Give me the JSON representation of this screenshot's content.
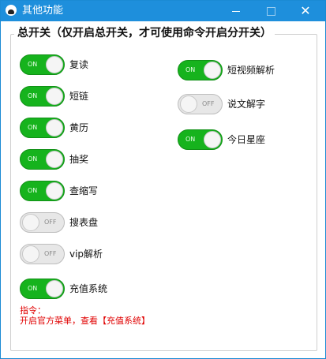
{
  "window": {
    "title": "其他功能",
    "minimize_icon": "minimize-icon",
    "maximize_icon": "maximize-icon",
    "close_icon": "close-icon"
  },
  "group": {
    "title": "总开关（仅开启总开关，才可使用命令开启分开关）"
  },
  "switch_on_text": "ON",
  "switch_off_text": "OFF",
  "colors": {
    "titlebar": "#1e8fdc",
    "switch_on": "#16b31d",
    "switch_off": "#e7e7e7",
    "command_text": "#e00000"
  },
  "left_switches": [
    {
      "label": "复读",
      "state": "ON",
      "on": true
    },
    {
      "label": "短链",
      "state": "ON",
      "on": true
    },
    {
      "label": "黄历",
      "state": "ON",
      "on": true
    },
    {
      "label": "抽奖",
      "state": "ON",
      "on": true
    },
    {
      "label": "查缩写",
      "state": "ON",
      "on": true
    },
    {
      "label": "搜表盘",
      "state": "OFF",
      "on": false
    },
    {
      "label": "vip解析",
      "state": "OFF",
      "on": false
    },
    {
      "label": "充值系统",
      "state": "ON",
      "on": true
    }
  ],
  "right_switches": [
    {
      "label": "短视频解析",
      "state": "ON",
      "on": true
    },
    {
      "label": "说文解字",
      "state": "OFF",
      "on": false
    },
    {
      "label": "今日星座",
      "state": "ON",
      "on": true
    }
  ],
  "command": {
    "heading": "指令：",
    "text": "开启官方菜单，查看【充值系统】"
  }
}
